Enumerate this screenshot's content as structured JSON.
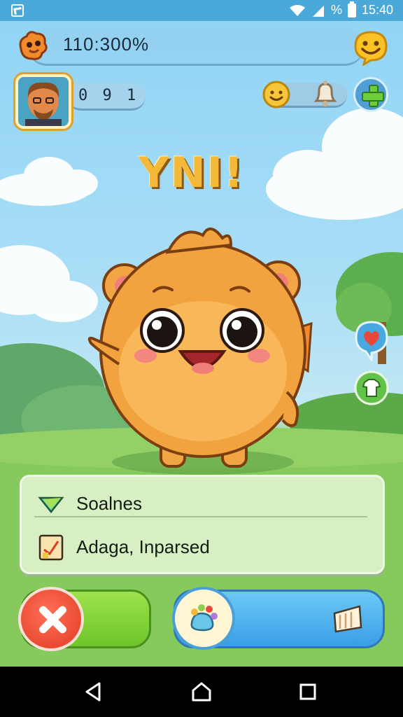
{
  "status_bar": {
    "battery_percent": "%",
    "time": "15:40"
  },
  "hud": {
    "score_text": "110:300%",
    "level_text": "0 9 1"
  },
  "game": {
    "title": "YNI!"
  },
  "info_panel": {
    "row1_label": "Soalnes",
    "row2_label": "Adaga, Inparsed"
  },
  "icons": {
    "logo": "mascot-logo-icon",
    "smile": "smiley-face-icon",
    "coin": "coin-icon",
    "bell": "bell-icon",
    "plus": "plus-icon",
    "heart": "heart-icon",
    "shirt": "shirt-icon",
    "gem": "gem-icon",
    "quest": "checklist-icon",
    "close": "close-icon",
    "paw": "paw-icon",
    "flag": "flag-icon"
  },
  "colors": {
    "accent_green": "#6cc62a",
    "accent_blue": "#3a9ee6",
    "accent_red": "#e23a25",
    "title_gold": "#f5b93a"
  }
}
